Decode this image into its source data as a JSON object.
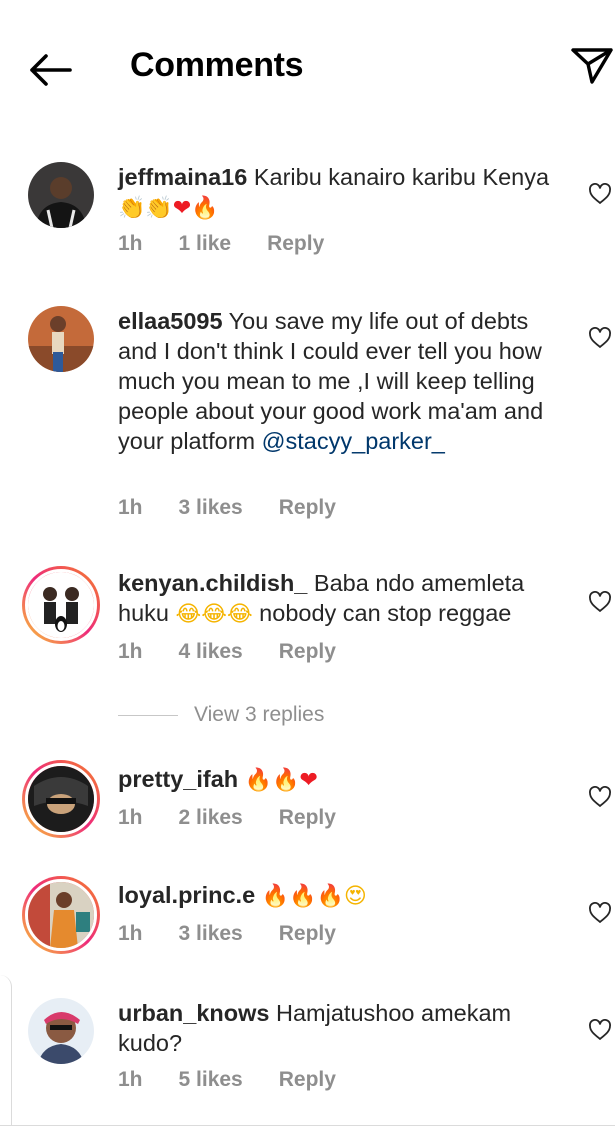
{
  "header": {
    "title": "Comments",
    "back_icon": "arrow-left-icon",
    "send_icon": "paper-plane-icon"
  },
  "comments": [
    {
      "username": "jeffmaina16",
      "text": " Karibu kanairo karibu Kenya",
      "emojis": [
        "👏",
        "👏",
        "❤",
        "🔥"
      ],
      "time": "1h",
      "likes": "1 like",
      "reply": "Reply"
    },
    {
      "username": "ellaa5095",
      "text": " You save my life out of debts and I don't think I could ever tell you how much you mean to me ,I will keep telling people about your good work ma'am and your platform ",
      "mention": "@stacyy_parker_",
      "time": "1h",
      "likes": "3 likes",
      "reply": "Reply"
    },
    {
      "username": "kenyan.childish_",
      "text": " Baba ndo amemleta huku ",
      "emojis": [
        "😂",
        "😂",
        "😂"
      ],
      "text_after": " nobody can stop reggae",
      "time": "1h",
      "likes": "4 likes",
      "reply": "Reply"
    },
    {
      "username": "pretty_ifah",
      "text": " ",
      "emojis": [
        "🔥",
        "🔥",
        "❤"
      ],
      "time": "1h",
      "likes": "2 likes",
      "reply": "Reply"
    },
    {
      "username": "loyal.princ.e",
      "text": " ",
      "emojis": [
        "🔥",
        "🔥",
        "🔥",
        "😍"
      ],
      "time": "1h",
      "likes": "3 likes",
      "reply": "Reply"
    },
    {
      "username": "urban_knows",
      "text": " Hamjatushoo amekam kudo?",
      "time": "1h",
      "likes": "5 likes",
      "reply": "Reply"
    }
  ],
  "view_replies": "View 3 replies",
  "colors": {
    "meta": "#8e8e8e",
    "mention": "#00376b",
    "text": "#262626"
  }
}
